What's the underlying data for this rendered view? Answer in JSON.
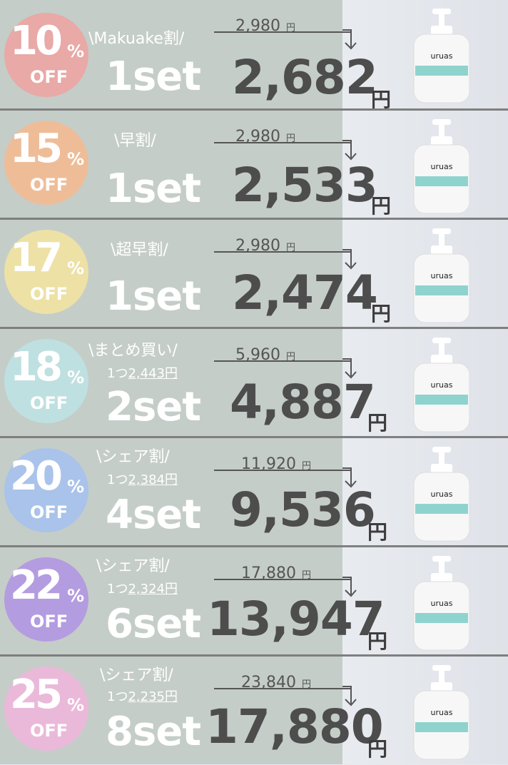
{
  "tiers": [
    {
      "pct": "10",
      "pct_sign": "%",
      "off": "OFF",
      "tagline": "\\Makuake割/",
      "unit_prefix": "",
      "unit_price": "",
      "sets": "1set",
      "old": "2,980",
      "old_yen": "円",
      "price": "2,682",
      "yen": "円",
      "badge_color": "#e8a9a7"
    },
    {
      "pct": "15",
      "pct_sign": "%",
      "off": "OFF",
      "tagline": "\\早割/",
      "unit_prefix": "",
      "unit_price": "",
      "sets": "1set",
      "old": "2,980",
      "old_yen": "円",
      "price": "2,533",
      "yen": "円",
      "badge_color": "#eebd98"
    },
    {
      "pct": "17",
      "pct_sign": "%",
      "off": "OFF",
      "tagline": "\\超早割/",
      "unit_prefix": "",
      "unit_price": "",
      "sets": "1set",
      "old": "2,980",
      "old_yen": "円",
      "price": "2,474",
      "yen": "円",
      "badge_color": "#ede1a6"
    },
    {
      "pct": "18",
      "pct_sign": "%",
      "off": "OFF",
      "tagline": "\\まとめ買い/",
      "unit_prefix": "1つ",
      "unit_price": "2,443円",
      "sets": "2set",
      "old": "5,960",
      "old_yen": "円",
      "price": "4,887",
      "yen": "円",
      "badge_color": "#bfe0e0"
    },
    {
      "pct": "20",
      "pct_sign": "%",
      "off": "OFF",
      "tagline": "\\シェア割/",
      "unit_prefix": "1つ",
      "unit_price": "2,384円",
      "sets": "4set",
      "old": "11,920",
      "old_yen": "円",
      "price": "9,536",
      "yen": "円",
      "badge_color": "#a9c3ea"
    },
    {
      "pct": "22",
      "pct_sign": "%",
      "off": "OFF",
      "tagline": "\\シェア割/",
      "unit_prefix": "1つ",
      "unit_price": "2,324円",
      "sets": "6set",
      "old": "17,880",
      "old_yen": "円",
      "price": "13,947",
      "yen": "円",
      "badge_color": "#b49ce0"
    },
    {
      "pct": "25",
      "pct_sign": "%",
      "off": "OFF",
      "tagline": "\\シェア割/",
      "unit_prefix": "1つ",
      "unit_price": "2,235円",
      "sets": "8set",
      "old": "23,840",
      "old_yen": "円",
      "price": "17,880",
      "yen": "円",
      "badge_color": "#eab9d9"
    }
  ],
  "product": {
    "logo": "uruas",
    "icon": "bottle-icon"
  }
}
